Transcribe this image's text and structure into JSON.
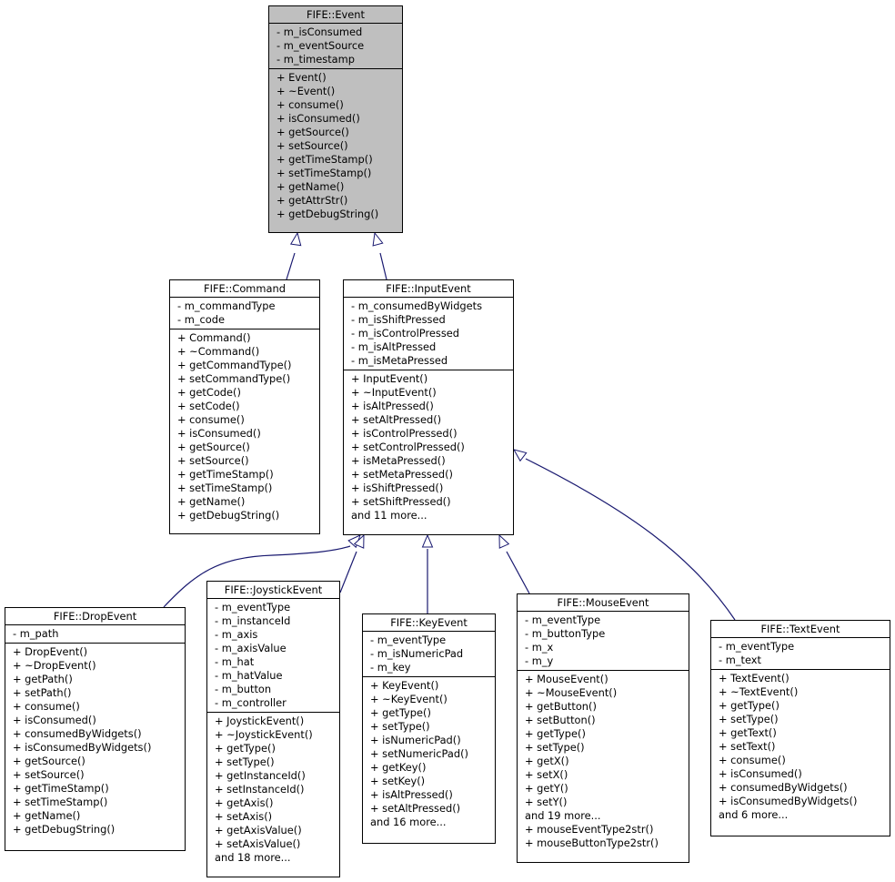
{
  "diagram": {
    "type": "class-inheritance",
    "edge_color": "#191970",
    "focus_fill": "#bfbfbf",
    "classes": {
      "event": {
        "name": "FIFE::Event",
        "attributes": [
          "- m_isConsumed",
          "- m_eventSource",
          "- m_timestamp"
        ],
        "operations": [
          "+ Event()",
          "+ ~Event()",
          "+ consume()",
          "+ isConsumed()",
          "+ getSource()",
          "+ setSource()",
          "+ getTimeStamp()",
          "+ setTimeStamp()",
          "+ getName()",
          "+ getAttrStr()",
          "+ getDebugString()"
        ]
      },
      "command": {
        "name": "FIFE::Command",
        "attributes": [
          "- m_commandType",
          "- m_code"
        ],
        "operations": [
          "+ Command()",
          "+ ~Command()",
          "+ getCommandType()",
          "+ setCommandType()",
          "+ getCode()",
          "+ setCode()",
          "+ consume()",
          "+ isConsumed()",
          "+ getSource()",
          "+ setSource()",
          "+ getTimeStamp()",
          "+ setTimeStamp()",
          "+ getName()",
          "+ getDebugString()"
        ]
      },
      "input_event": {
        "name": "FIFE::InputEvent",
        "attributes": [
          "- m_consumedByWidgets",
          "- m_isShiftPressed",
          "- m_isControlPressed",
          "- m_isAltPressed",
          "- m_isMetaPressed"
        ],
        "operations": [
          "+ InputEvent()",
          "+ ~InputEvent()",
          "+ isAltPressed()",
          "+ setAltPressed()",
          "+ isControlPressed()",
          "+ setControlPressed()",
          "+ isMetaPressed()",
          "+ setMetaPressed()",
          "+ isShiftPressed()",
          "+ setShiftPressed()",
          "and 11 more..."
        ]
      },
      "drop_event": {
        "name": "FIFE::DropEvent",
        "attributes": [
          "- m_path"
        ],
        "operations": [
          "+ DropEvent()",
          "+ ~DropEvent()",
          "+ getPath()",
          "+ setPath()",
          "+ consume()",
          "+ isConsumed()",
          "+ consumedByWidgets()",
          "+ isConsumedByWidgets()",
          "+ getSource()",
          "+ setSource()",
          "+ getTimeStamp()",
          "+ setTimeStamp()",
          "+ getName()",
          "+ getDebugString()"
        ]
      },
      "joystick_event": {
        "name": "FIFE::JoystickEvent",
        "attributes": [
          "- m_eventType",
          "- m_instanceId",
          "- m_axis",
          "- m_axisValue",
          "- m_hat",
          "- m_hatValue",
          "- m_button",
          "- m_controller"
        ],
        "operations": [
          "+ JoystickEvent()",
          "+ ~JoystickEvent()",
          "+ getType()",
          "+ setType()",
          "+ getInstanceId()",
          "+ setInstanceId()",
          "+ getAxis()",
          "+ setAxis()",
          "+ getAxisValue()",
          "+ setAxisValue()",
          "and 18 more..."
        ]
      },
      "key_event": {
        "name": "FIFE::KeyEvent",
        "attributes": [
          "- m_eventType",
          "- m_isNumericPad",
          "- m_key"
        ],
        "operations": [
          "+ KeyEvent()",
          "+ ~KeyEvent()",
          "+ getType()",
          "+ setType()",
          "+ isNumericPad()",
          "+ setNumericPad()",
          "+ getKey()",
          "+ setKey()",
          "+ isAltPressed()",
          "+ setAltPressed()",
          "and 16 more..."
        ]
      },
      "mouse_event": {
        "name": "FIFE::MouseEvent",
        "attributes": [
          "- m_eventType",
          "- m_buttonType",
          "- m_x",
          "- m_y"
        ],
        "operations": [
          "+ MouseEvent()",
          "+ ~MouseEvent()",
          "+ getButton()",
          "+ setButton()",
          "+ getType()",
          "+ setType()",
          "+ getX()",
          "+ setX()",
          "+ getY()",
          "+ setY()",
          "and 19 more...",
          "+ mouseEventType2str()",
          "+ mouseButtonType2str()"
        ]
      },
      "text_event": {
        "name": "FIFE::TextEvent",
        "attributes": [
          "- m_eventType",
          "- m_text"
        ],
        "operations": [
          "+ TextEvent()",
          "+ ~TextEvent()",
          "+ getType()",
          "+ setType()",
          "+ getText()",
          "+ setText()",
          "+ consume()",
          "+ isConsumed()",
          "+ consumedByWidgets()",
          "+ isConsumedByWidgets()",
          "and 6 more..."
        ]
      }
    },
    "inheritance": [
      {
        "child": "command",
        "parent": "event"
      },
      {
        "child": "input_event",
        "parent": "event"
      },
      {
        "child": "drop_event",
        "parent": "input_event"
      },
      {
        "child": "joystick_event",
        "parent": "input_event"
      },
      {
        "child": "key_event",
        "parent": "input_event"
      },
      {
        "child": "mouse_event",
        "parent": "input_event"
      },
      {
        "child": "text_event",
        "parent": "input_event"
      }
    ]
  }
}
